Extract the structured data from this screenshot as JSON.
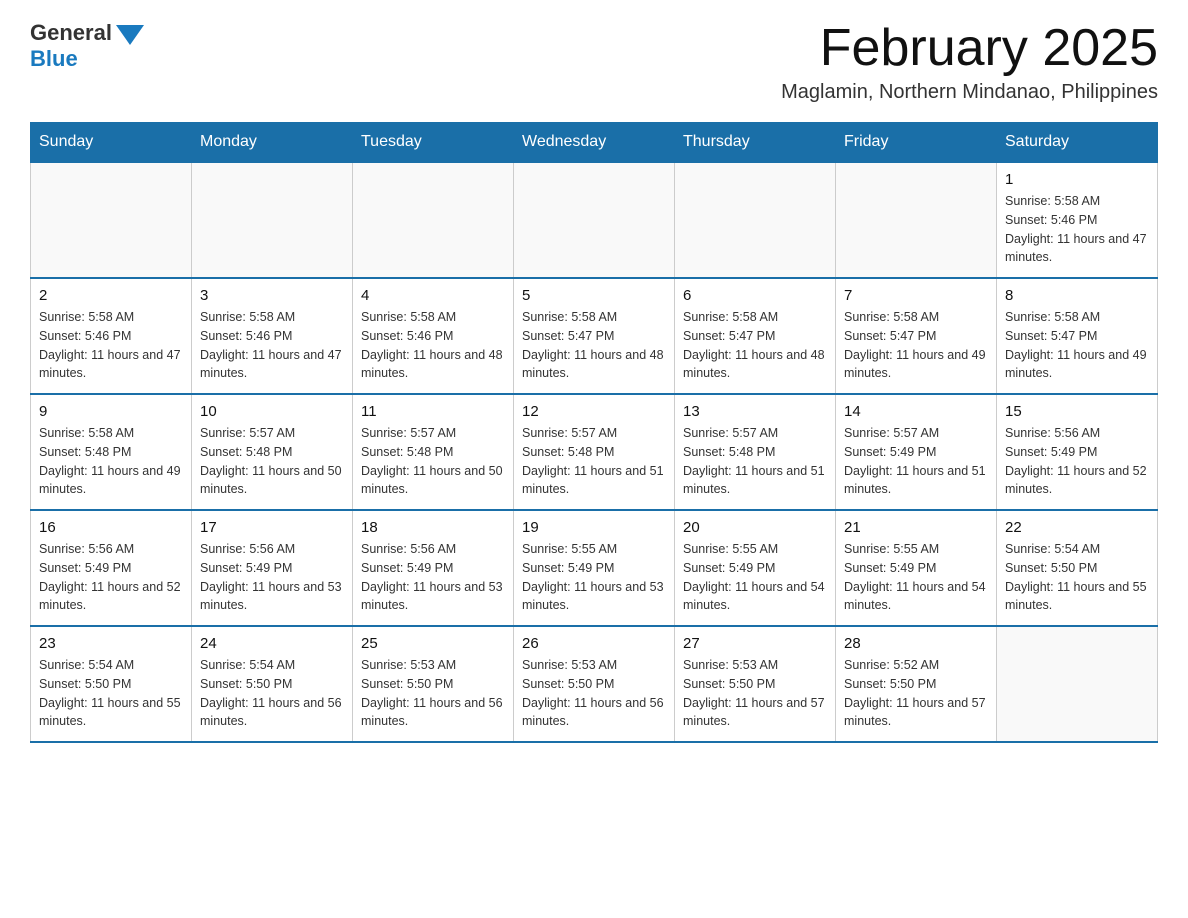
{
  "header": {
    "logo_general": "General",
    "logo_blue": "Blue",
    "month_title": "February 2025",
    "location": "Maglamin, Northern Mindanao, Philippines"
  },
  "days_of_week": [
    "Sunday",
    "Monday",
    "Tuesday",
    "Wednesday",
    "Thursday",
    "Friday",
    "Saturday"
  ],
  "weeks": [
    [
      {
        "day": "",
        "info": ""
      },
      {
        "day": "",
        "info": ""
      },
      {
        "day": "",
        "info": ""
      },
      {
        "day": "",
        "info": ""
      },
      {
        "day": "",
        "info": ""
      },
      {
        "day": "",
        "info": ""
      },
      {
        "day": "1",
        "info": "Sunrise: 5:58 AM\nSunset: 5:46 PM\nDaylight: 11 hours and 47 minutes."
      }
    ],
    [
      {
        "day": "2",
        "info": "Sunrise: 5:58 AM\nSunset: 5:46 PM\nDaylight: 11 hours and 47 minutes."
      },
      {
        "day": "3",
        "info": "Sunrise: 5:58 AM\nSunset: 5:46 PM\nDaylight: 11 hours and 47 minutes."
      },
      {
        "day": "4",
        "info": "Sunrise: 5:58 AM\nSunset: 5:46 PM\nDaylight: 11 hours and 48 minutes."
      },
      {
        "day": "5",
        "info": "Sunrise: 5:58 AM\nSunset: 5:47 PM\nDaylight: 11 hours and 48 minutes."
      },
      {
        "day": "6",
        "info": "Sunrise: 5:58 AM\nSunset: 5:47 PM\nDaylight: 11 hours and 48 minutes."
      },
      {
        "day": "7",
        "info": "Sunrise: 5:58 AM\nSunset: 5:47 PM\nDaylight: 11 hours and 49 minutes."
      },
      {
        "day": "8",
        "info": "Sunrise: 5:58 AM\nSunset: 5:47 PM\nDaylight: 11 hours and 49 minutes."
      }
    ],
    [
      {
        "day": "9",
        "info": "Sunrise: 5:58 AM\nSunset: 5:48 PM\nDaylight: 11 hours and 49 minutes."
      },
      {
        "day": "10",
        "info": "Sunrise: 5:57 AM\nSunset: 5:48 PM\nDaylight: 11 hours and 50 minutes."
      },
      {
        "day": "11",
        "info": "Sunrise: 5:57 AM\nSunset: 5:48 PM\nDaylight: 11 hours and 50 minutes."
      },
      {
        "day": "12",
        "info": "Sunrise: 5:57 AM\nSunset: 5:48 PM\nDaylight: 11 hours and 51 minutes."
      },
      {
        "day": "13",
        "info": "Sunrise: 5:57 AM\nSunset: 5:48 PM\nDaylight: 11 hours and 51 minutes."
      },
      {
        "day": "14",
        "info": "Sunrise: 5:57 AM\nSunset: 5:49 PM\nDaylight: 11 hours and 51 minutes."
      },
      {
        "day": "15",
        "info": "Sunrise: 5:56 AM\nSunset: 5:49 PM\nDaylight: 11 hours and 52 minutes."
      }
    ],
    [
      {
        "day": "16",
        "info": "Sunrise: 5:56 AM\nSunset: 5:49 PM\nDaylight: 11 hours and 52 minutes."
      },
      {
        "day": "17",
        "info": "Sunrise: 5:56 AM\nSunset: 5:49 PM\nDaylight: 11 hours and 53 minutes."
      },
      {
        "day": "18",
        "info": "Sunrise: 5:56 AM\nSunset: 5:49 PM\nDaylight: 11 hours and 53 minutes."
      },
      {
        "day": "19",
        "info": "Sunrise: 5:55 AM\nSunset: 5:49 PM\nDaylight: 11 hours and 53 minutes."
      },
      {
        "day": "20",
        "info": "Sunrise: 5:55 AM\nSunset: 5:49 PM\nDaylight: 11 hours and 54 minutes."
      },
      {
        "day": "21",
        "info": "Sunrise: 5:55 AM\nSunset: 5:49 PM\nDaylight: 11 hours and 54 minutes."
      },
      {
        "day": "22",
        "info": "Sunrise: 5:54 AM\nSunset: 5:50 PM\nDaylight: 11 hours and 55 minutes."
      }
    ],
    [
      {
        "day": "23",
        "info": "Sunrise: 5:54 AM\nSunset: 5:50 PM\nDaylight: 11 hours and 55 minutes."
      },
      {
        "day": "24",
        "info": "Sunrise: 5:54 AM\nSunset: 5:50 PM\nDaylight: 11 hours and 56 minutes."
      },
      {
        "day": "25",
        "info": "Sunrise: 5:53 AM\nSunset: 5:50 PM\nDaylight: 11 hours and 56 minutes."
      },
      {
        "day": "26",
        "info": "Sunrise: 5:53 AM\nSunset: 5:50 PM\nDaylight: 11 hours and 56 minutes."
      },
      {
        "day": "27",
        "info": "Sunrise: 5:53 AM\nSunset: 5:50 PM\nDaylight: 11 hours and 57 minutes."
      },
      {
        "day": "28",
        "info": "Sunrise: 5:52 AM\nSunset: 5:50 PM\nDaylight: 11 hours and 57 minutes."
      },
      {
        "day": "",
        "info": ""
      }
    ]
  ]
}
